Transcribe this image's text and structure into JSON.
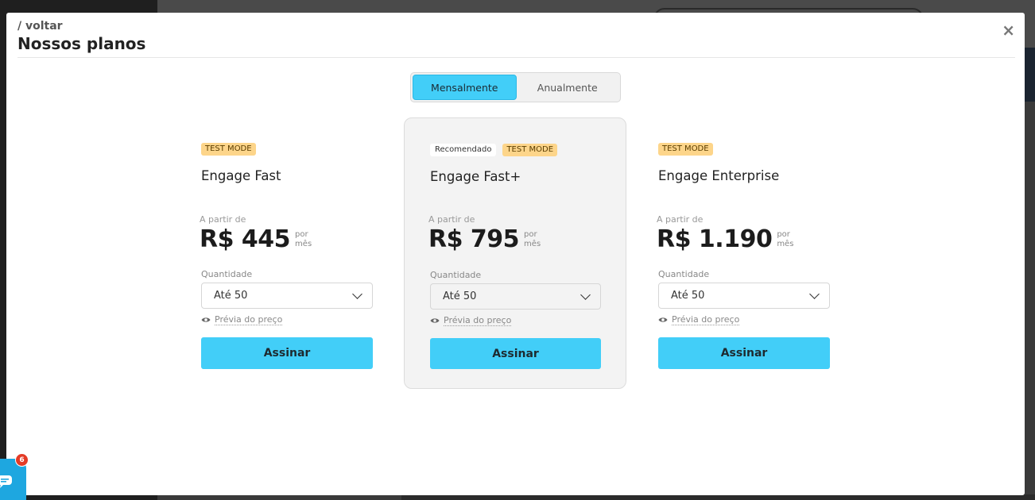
{
  "modal": {
    "back_label": "/ voltar",
    "title": "Nossos planos",
    "close_label": "×"
  },
  "billing_toggle": {
    "options": [
      "Mensalmente",
      "Anualmente"
    ],
    "selected": "Mensalmente"
  },
  "plans": [
    {
      "badges": [
        "TEST MODE"
      ],
      "name": "Engage Fast",
      "from_label": "A partir de",
      "price": "R$ 445",
      "per_line1": "por",
      "per_line2": "mês",
      "quantity_label": "Quantidade",
      "quantity_value": "Até 50",
      "preview_label": "Prévia do preço",
      "cta": "Assinar",
      "featured": false
    },
    {
      "recommended_label": "Recomendado",
      "badges": [
        "TEST MODE"
      ],
      "name": "Engage Fast+",
      "from_label": "A partir de",
      "price": "R$ 795",
      "per_line1": "por",
      "per_line2": "mês",
      "quantity_label": "Quantidade",
      "quantity_value": "Até 50",
      "preview_label": "Prévia do preço",
      "cta": "Assinar",
      "featured": true
    },
    {
      "badges": [
        "TEST MODE"
      ],
      "name": "Engage Enterprise",
      "from_label": "A partir de",
      "price": "R$ 1.190",
      "per_line1": "por",
      "per_line2": "mês",
      "quantity_label": "Quantidade",
      "quantity_value": "Até 50",
      "preview_label": "Prévia do preço",
      "cta": "Assinar",
      "featured": false
    }
  ],
  "chat_widget": {
    "unread_count": "6",
    "icon": "chat-bubble-icon"
  },
  "colors": {
    "accent": "#42cef8",
    "badge_test": "#fdd58a",
    "notification": "#e43b26"
  }
}
